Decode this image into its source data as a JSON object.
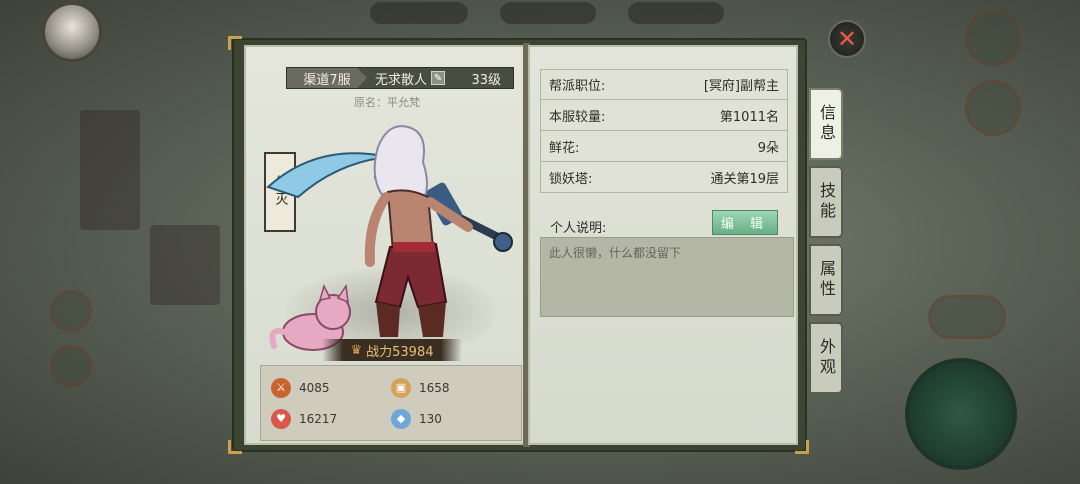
{
  "header": {
    "server": "渠道7服",
    "player_name": "无求散人",
    "level": "33级",
    "original_name": "原名：平允梵"
  },
  "character": {
    "title_badge": "绝灭",
    "power_label": "战力53984"
  },
  "stats": [
    {
      "icon": "sword-icon",
      "value": "4085",
      "color": "#c9642f"
    },
    {
      "icon": "armor-icon",
      "value": "1658",
      "color": "#d4a35a"
    },
    {
      "icon": "heart-icon",
      "value": "16217",
      "color": "#d9574b"
    },
    {
      "icon": "shield-crystal-icon",
      "value": "130",
      "color": "#6fa6d8"
    }
  ],
  "info": {
    "rows": [
      {
        "label": "帮派职位:",
        "value": "[冥府]副帮主"
      },
      {
        "label": "本服较量:",
        "value": "第1011名"
      },
      {
        "label": "鲜花:",
        "value": "9朵"
      },
      {
        "label": "锁妖塔:",
        "value": "通关第19层"
      }
    ],
    "intro_label": "个人说明:",
    "edit_label": "编 辑",
    "intro_text": "此人很懒，什么都没留下"
  },
  "tabs": [
    {
      "label": "信息",
      "active": true
    },
    {
      "label": "技能",
      "active": false
    },
    {
      "label": "属性",
      "active": false
    },
    {
      "label": "外观",
      "active": false
    }
  ],
  "close_icon": "close-x-icon"
}
